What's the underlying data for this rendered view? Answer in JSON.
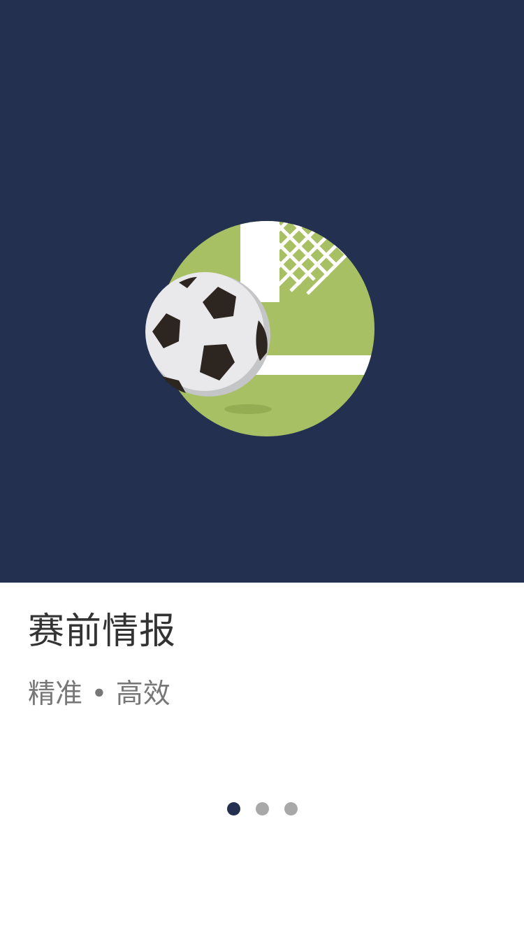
{
  "onboarding": {
    "title": "赛前情报",
    "subtitle": "精准 • 高效",
    "illustration": "soccer-ball-goal-illustration",
    "page_indicator": {
      "total": 3,
      "current": 1
    }
  },
  "colors": {
    "hero_background": "#23304f",
    "pitch_green": "#a8c064",
    "title_text": "#333333",
    "subtitle_text": "#777777",
    "dot_active": "#23304f",
    "dot_inactive": "#a8a8a8"
  }
}
